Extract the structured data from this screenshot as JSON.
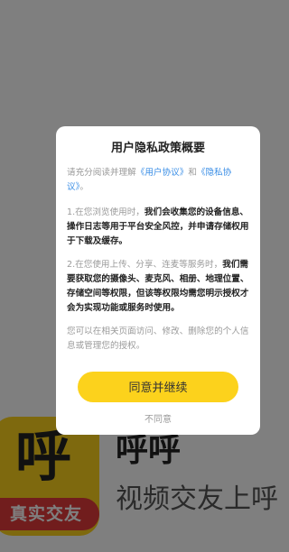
{
  "splash": {
    "logo_char": "呼",
    "logo_banner": "真实交友",
    "app_name": "呼呼",
    "slogan": "视频交友上呼"
  },
  "dialog": {
    "title": "用户隐私政策概要",
    "intro_prefix": "请充分阅读并理解",
    "user_agreement_link": "《用户协议》",
    "intro_and": "和",
    "privacy_link": "《隐私协议》",
    "intro_suffix": "。",
    "p2_gray": "1.在您浏览使用时，",
    "p2_bold": "我们会收集您的设备信息、操作日志等用于平台安全风控，并申请存储权用于下载及缓存。",
    "p3_gray": "2.在您使用上传、分享、连麦等服务时，",
    "p3_bold": "我们需要获取您的摄像头、麦克风、相册、地理位置、存储空间等权限，但该等权限均需您明示授权才会为实现功能或服务时使用。",
    "p4": "您可以在相关页面访问、修改、删除您的个人信息或管理您的授权。",
    "agree_button": "同意并继续",
    "disagree_link": "不同意"
  },
  "colors": {
    "accent": "#fcd21c",
    "link": "#3a8ee6",
    "banner": "#e23b3b",
    "overlay": "rgba(0,0,0,0.5)"
  }
}
